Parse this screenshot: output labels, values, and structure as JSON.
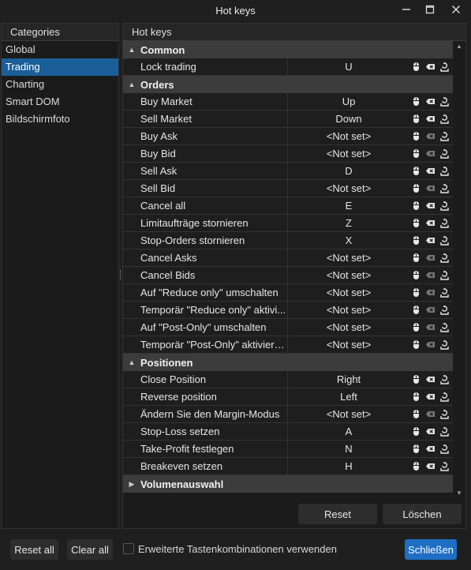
{
  "window": {
    "title": "Hot keys"
  },
  "categories": {
    "header": "Categories",
    "items": [
      "Global",
      "Trading",
      "Charting",
      "Smart DOM",
      "Bildschirmfoto"
    ],
    "selected": "Trading"
  },
  "hotkeys": {
    "header": "Hot keys",
    "groups": [
      {
        "name": "Common",
        "expanded": true,
        "rows": [
          {
            "name": "Lock trading",
            "key": "U"
          }
        ]
      },
      {
        "name": "Orders",
        "expanded": true,
        "rows": [
          {
            "name": "Buy Market",
            "key": "Up"
          },
          {
            "name": "Sell Market",
            "key": "Down"
          },
          {
            "name": "Buy Ask",
            "key": "<Not set>"
          },
          {
            "name": "Buy Bid",
            "key": "<Not set>"
          },
          {
            "name": "Sell Ask",
            "key": "D"
          },
          {
            "name": "Sell Bid",
            "key": "<Not set>"
          },
          {
            "name": "Cancel all",
            "key": "E"
          },
          {
            "name": "Limitaufträge stornieren",
            "key": "Z"
          },
          {
            "name": "Stop-Orders stornieren",
            "key": "X"
          },
          {
            "name": "Cancel Asks",
            "key": "<Not set>"
          },
          {
            "name": "Cancel Bids",
            "key": "<Not set>"
          },
          {
            "name": "Auf \"Reduce only\" umschalten",
            "key": "<Not set>"
          },
          {
            "name": "Temporär \"Reduce only\" aktivi...",
            "key": "<Not set>"
          },
          {
            "name": "Auf \"Post-Only\" umschalten",
            "key": "<Not set>"
          },
          {
            "name": "Temporär \"Post-Only\" aktiviere...",
            "key": "<Not set>"
          }
        ]
      },
      {
        "name": "Positionen",
        "expanded": true,
        "rows": [
          {
            "name": "Close Position",
            "key": "Right"
          },
          {
            "name": "Reverse position",
            "key": "Left"
          },
          {
            "name": "Ändern Sie den Margin-Modus",
            "key": "<Not set>"
          },
          {
            "name": "Stop-Loss setzen",
            "key": "A"
          },
          {
            "name": "Take-Profit festlegen",
            "key": "N"
          },
          {
            "name": "Breakeven setzen",
            "key": "H"
          }
        ]
      },
      {
        "name": "Volumenauswahl",
        "expanded": false,
        "rows": []
      }
    ]
  },
  "buttons": {
    "reset": "Reset",
    "loeschen": "Löschen",
    "reset_all": "Reset all",
    "clear_all": "Clear all",
    "close": "Schließen"
  },
  "options": {
    "extended_combinations_label": "Erweiterte Tastenkombinationen verwenden",
    "extended_combinations_checked": false
  },
  "colors": {
    "accent": "#1e6fc4",
    "selected": "#1a5f99",
    "group_bg": "#3c3c3c"
  }
}
